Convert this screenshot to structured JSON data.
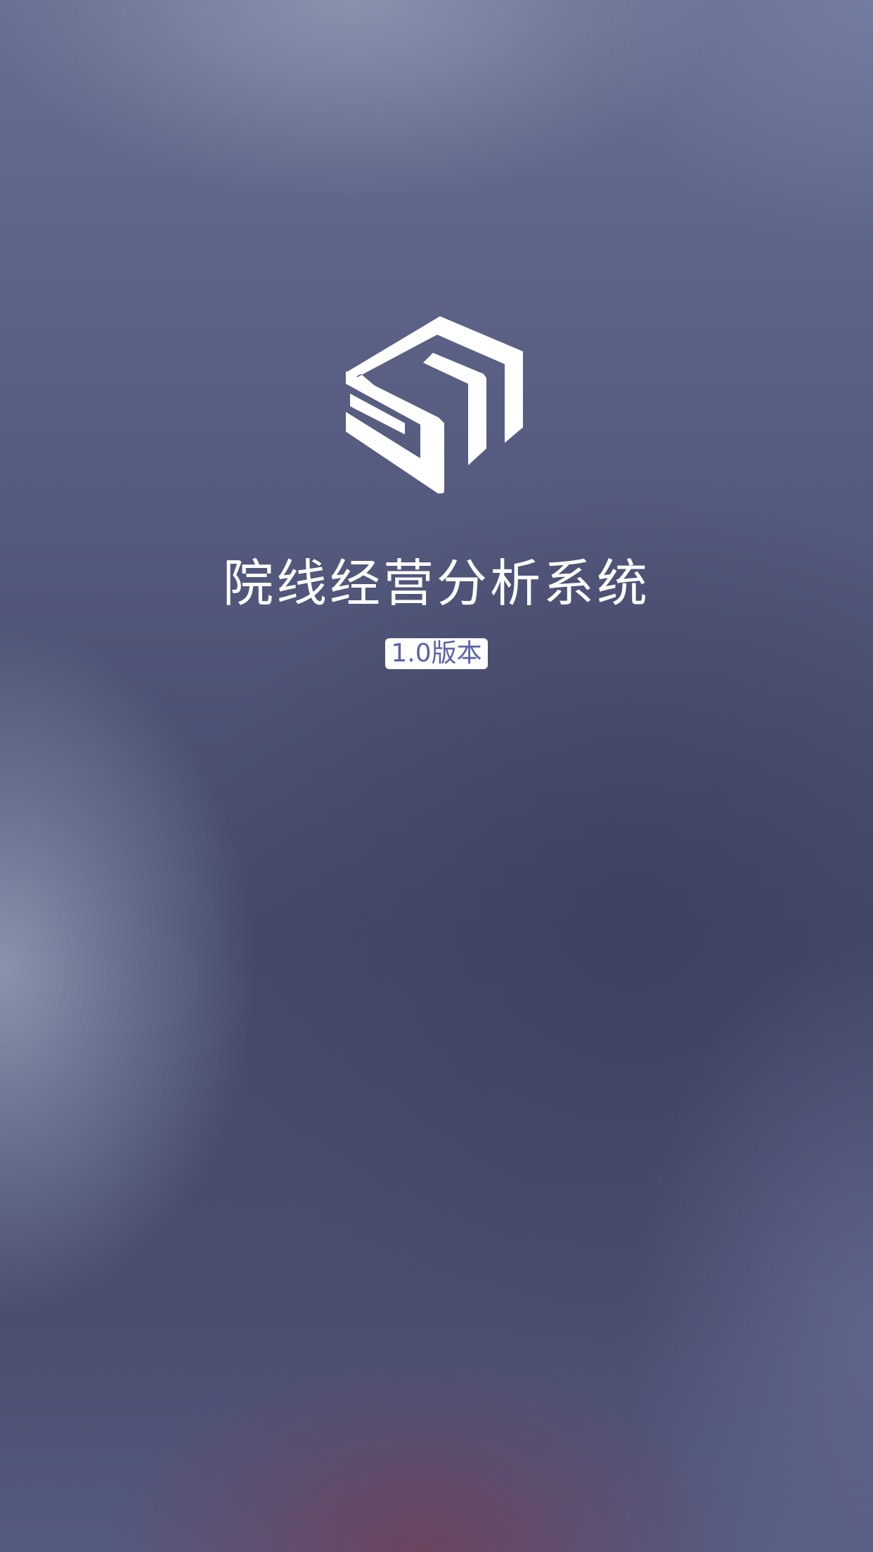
{
  "splash": {
    "logo_icon": "cube-s-logo-icon",
    "app_title": "院线经营分析系统",
    "version_label": "1.0版本",
    "colors": {
      "logo": "#ffffff",
      "title": "#ffffff",
      "badge_background": "#ffffff",
      "badge_text": "#5a63a8"
    }
  }
}
